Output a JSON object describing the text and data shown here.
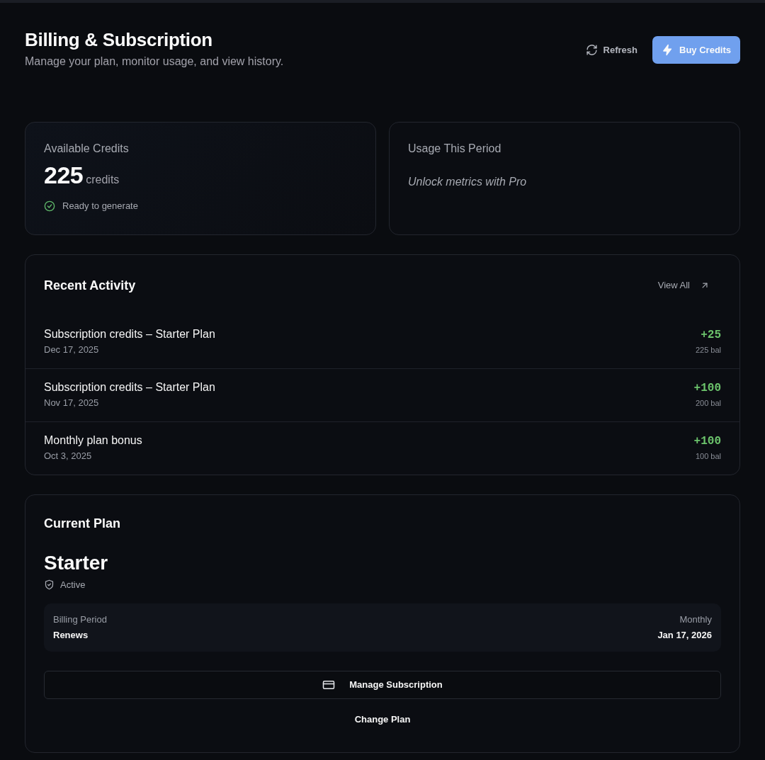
{
  "header": {
    "title": "Billing & Subscription",
    "subtitle": "Manage your plan, monitor usage, and view history.",
    "buttons": [
      {
        "kind": "ghost",
        "label": "Refresh"
      },
      {
        "kind": "primary",
        "label": "Buy Credits"
      }
    ]
  },
  "credits": {
    "title": "Available Credits",
    "amount": "225",
    "unit": "credits",
    "status": "Ready to generate"
  },
  "usage": {
    "title": "Usage This Period",
    "note": "Unlock metrics with Pro"
  },
  "activity": {
    "title": "Recent Activity",
    "link": "View All",
    "items": [
      {
        "title": "Subscription credits – Starter Plan",
        "date": "Dec 17, 2025",
        "amount": "+25",
        "balance": "225 bal"
      },
      {
        "title": "Subscription credits – Starter Plan",
        "date": "Nov 17, 2025",
        "amount": "+100",
        "balance": "200 bal"
      },
      {
        "title": "Monthly plan bonus",
        "date": "Oct 3, 2025",
        "amount": "+100",
        "balance": "100 bal"
      }
    ]
  },
  "plan": {
    "title": "Current Plan",
    "name": "Starter",
    "status": "Active",
    "details": [
      {
        "caption": "Billing Period",
        "value": "Renews"
      },
      {
        "caption": "Monthly",
        "value": "Jan 17, 2026"
      }
    ],
    "buttons": [
      {
        "kind": "outline",
        "label": "Manage Subscription"
      },
      {
        "kind": "plain",
        "label": "Change Plan"
      }
    ]
  }
}
